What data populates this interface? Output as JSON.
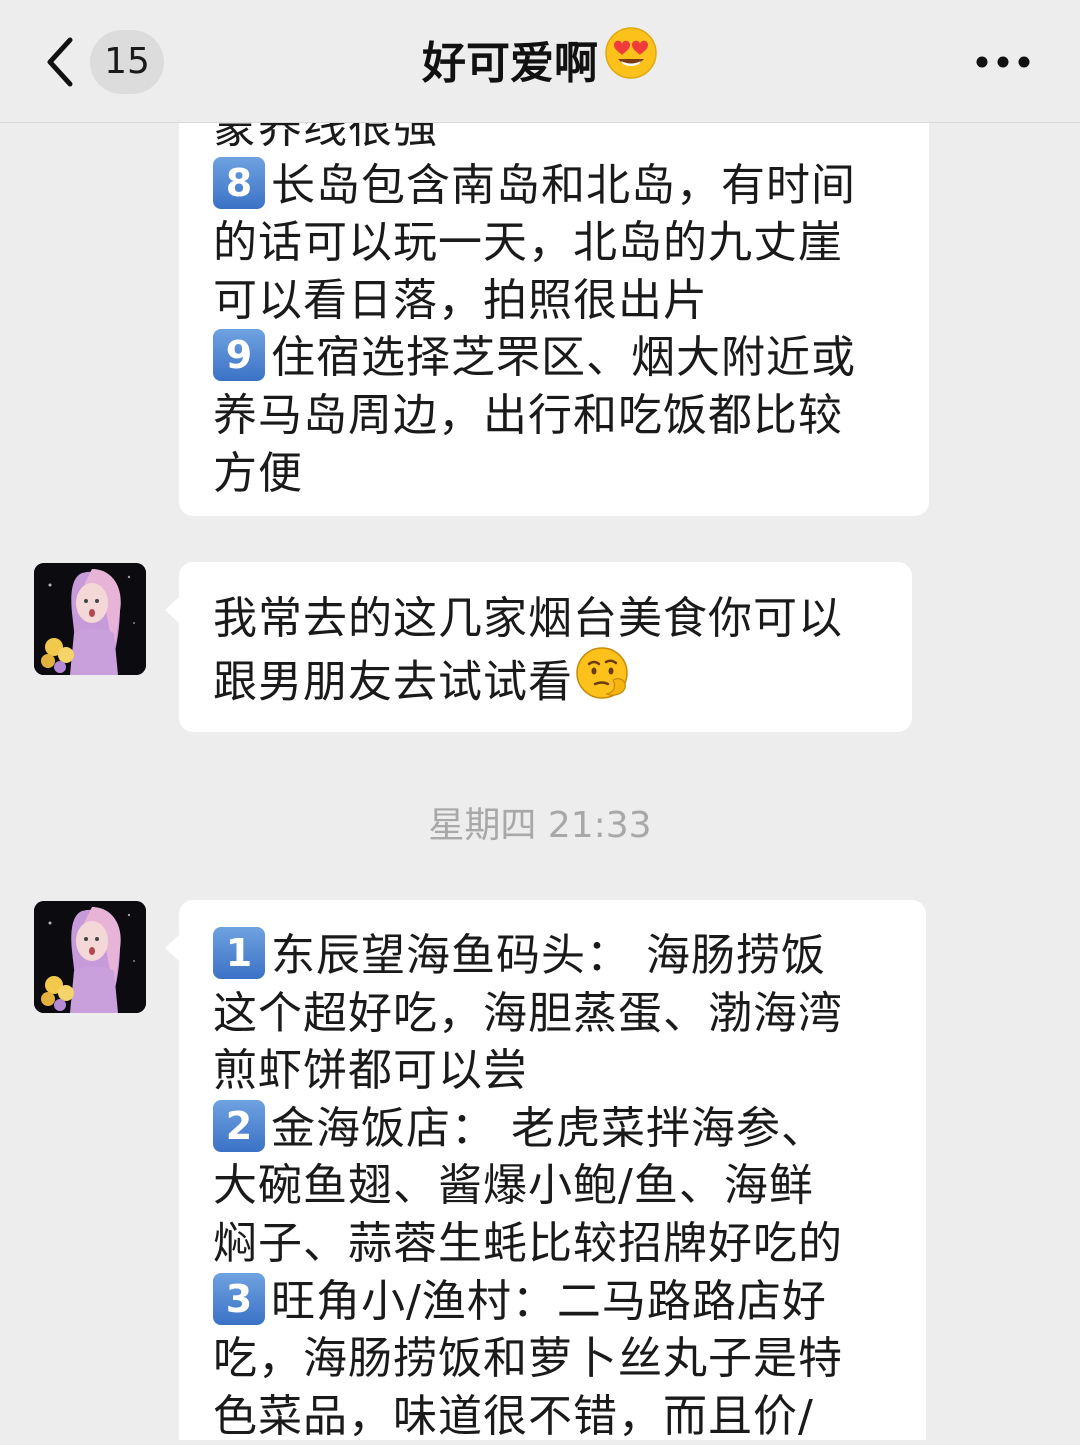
{
  "header": {
    "back_icon": "chevron-left-icon",
    "unread_count": "15",
    "title": "好可爱啊",
    "title_emoji": "heart-eyes-emoji",
    "more_icon": "more-dots-icon"
  },
  "messages": [
    {
      "type": "text",
      "lines": [
        "蒙养线很强",
        "长岛包含南岛和北岛，有时间",
        "的话可以玩一天，北岛的九丈崖",
        "可以看日落，拍照很出片",
        "住宿选择芝罘区、烟大附近或",
        "养马岛周边，出行和吃饭都比较",
        "方便"
      ],
      "badges": [
        "8",
        "9"
      ]
    },
    {
      "type": "text",
      "lines": [
        "我常去的这几家烟台美食你可以",
        "跟男朋友去试试看"
      ],
      "trailing_emoji": "thinking-emoji"
    },
    {
      "type": "timestamp",
      "text": "星期四 21:33"
    },
    {
      "type": "text",
      "lines": [
        "东辰望海鱼码头： 海肠捞饭",
        "这个超好吃，海胆蒸蛋、渤海湾",
        "煎虾饼都可以尝",
        "金海饭店： 老虎菜拌海参、",
        "大碗鱼翅、酱爆小鲍/鱼、海鲜",
        "焖子、蒜蓉生蚝比较招牌好吃的",
        "旺角小/渔村：二马路路店好",
        "吃，海肠捞饭和萝卜丝丸子是特",
        "色菜品，味道很不错，而且价/"
      ],
      "badges": [
        "1",
        "2",
        "3"
      ]
    }
  ],
  "colors": {
    "background": "#ededed",
    "bubble": "#ffffff",
    "badge_blue": "#4a80cf",
    "timestamp": "#a8a8a8"
  }
}
